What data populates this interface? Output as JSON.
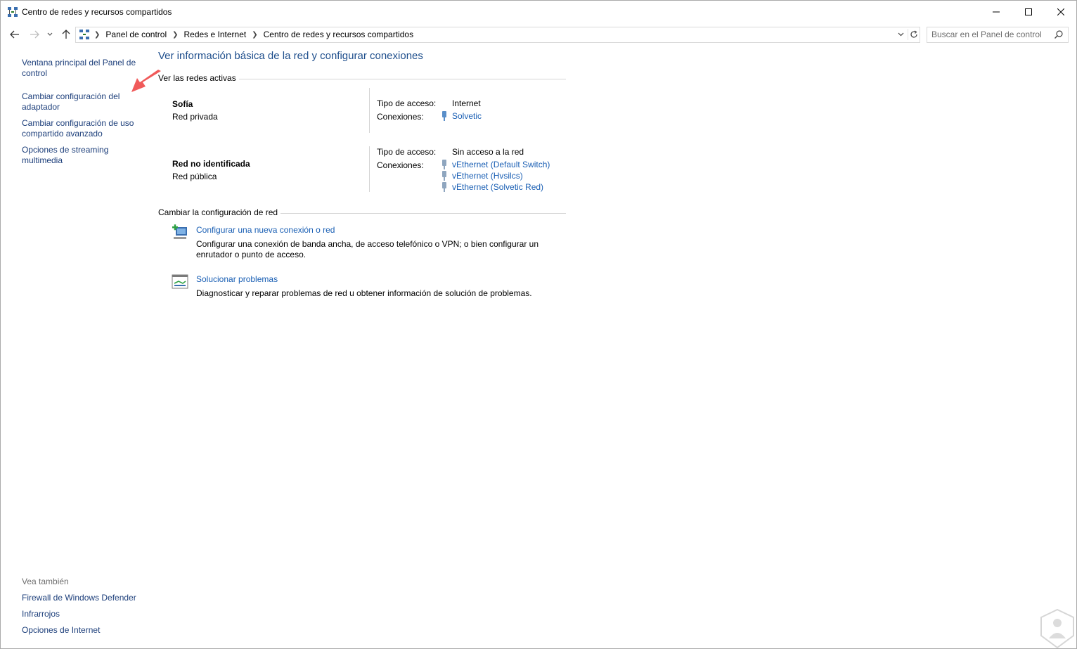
{
  "window": {
    "title": "Centro de redes y recursos compartidos",
    "minimize_icon": "minimize-icon",
    "maximize_icon": "maximize-icon",
    "close_icon": "close-icon"
  },
  "address": {
    "breadcrumbs": [
      "Panel de control",
      "Redes e Internet",
      "Centro de redes y recursos compartidos"
    ],
    "search_placeholder": "Buscar en el Panel de control"
  },
  "left_pane": {
    "links": [
      "Ventana principal del Panel de control",
      "Cambiar configuración del adaptador",
      "Cambiar configuración de uso compartido avanzado",
      "Opciones de streaming multimedia"
    ],
    "see_also_heading": "Vea también",
    "see_also": [
      "Firewall de Windows Defender",
      "Infrarrojos",
      "Opciones de Internet"
    ]
  },
  "main": {
    "title": "Ver información básica de la red y configurar conexiones",
    "active_networks_heading": "Ver las redes activas",
    "networks": [
      {
        "name": "Sofía",
        "type": "Red privada",
        "access_label": "Tipo de acceso:",
        "access_value": "Internet",
        "connections_label": "Conexiones:",
        "connections": [
          "Solvetic"
        ]
      },
      {
        "name": "Red no identificada",
        "type": "Red pública",
        "access_label": "Tipo de acceso:",
        "access_value": "Sin acceso a la red",
        "connections_label": "Conexiones:",
        "connections": [
          "vEthernet (Default Switch)",
          "vEthernet (Hvsilcs)",
          "vEthernet (Solvetic Red)"
        ]
      }
    ],
    "change_settings_heading": "Cambiar la configuración de red",
    "tasks": [
      {
        "link": "Configurar una nueva conexión o red",
        "description": "Configurar una conexión de banda ancha, de acceso telefónico o VPN; o bien configurar un enrutador o punto de acceso."
      },
      {
        "link": "Solucionar problemas",
        "description": "Diagnosticar y reparar problemas de red u obtener información de solución de problemas."
      }
    ]
  },
  "colors": {
    "link": "#1a5fb4",
    "title": "#1e4e8c",
    "annotation_arrow": "#f05a5a"
  }
}
